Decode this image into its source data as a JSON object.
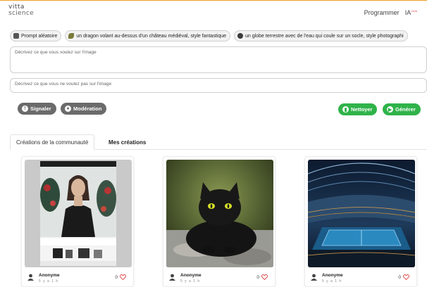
{
  "header": {
    "logo_line1": "vitta",
    "logo_line2": "science",
    "nav_programmer": "Programmer",
    "nav_ia": "IA",
    "nav_ia_badge": "beta"
  },
  "prompt_chips": [
    {
      "label": "Prompt aléatoire",
      "icon": "grid-icon"
    },
    {
      "label": "un dragon volant au-dessus d'un château médiéval, style fantastique",
      "icon": "leaf-icon"
    },
    {
      "label": "un globe terrestre avec de l'eau qui coule sur un socle, style photographi",
      "icon": "globe-icon"
    }
  ],
  "inputs": {
    "positive_placeholder": "Décrivez ce que vous voulez sur l'image",
    "negative_placeholder": "Décrivez ce que vous ne voulez pas sur l'image"
  },
  "actions": {
    "report": "Signaler",
    "moderation": "Modération",
    "clean": "Nettoyer",
    "generate": "Générer"
  },
  "tabs": {
    "community": "Créations de la communauté",
    "mine": "Mes créations"
  },
  "cards": [
    {
      "author": "Anonyme",
      "ago": "5 y a 1 h",
      "likes": "0",
      "image": "fashion-poster"
    },
    {
      "author": "Anonyme",
      "ago": "5 y a 1 h",
      "likes": "0",
      "image": "black-cat"
    },
    {
      "author": "Anonyme",
      "ago": "5 y a 1 h",
      "likes": "0",
      "image": "stadium"
    }
  ],
  "colors": {
    "accent_green": "#2fb34a",
    "button_grey": "#6b6b6b",
    "heart": "#e04040"
  }
}
